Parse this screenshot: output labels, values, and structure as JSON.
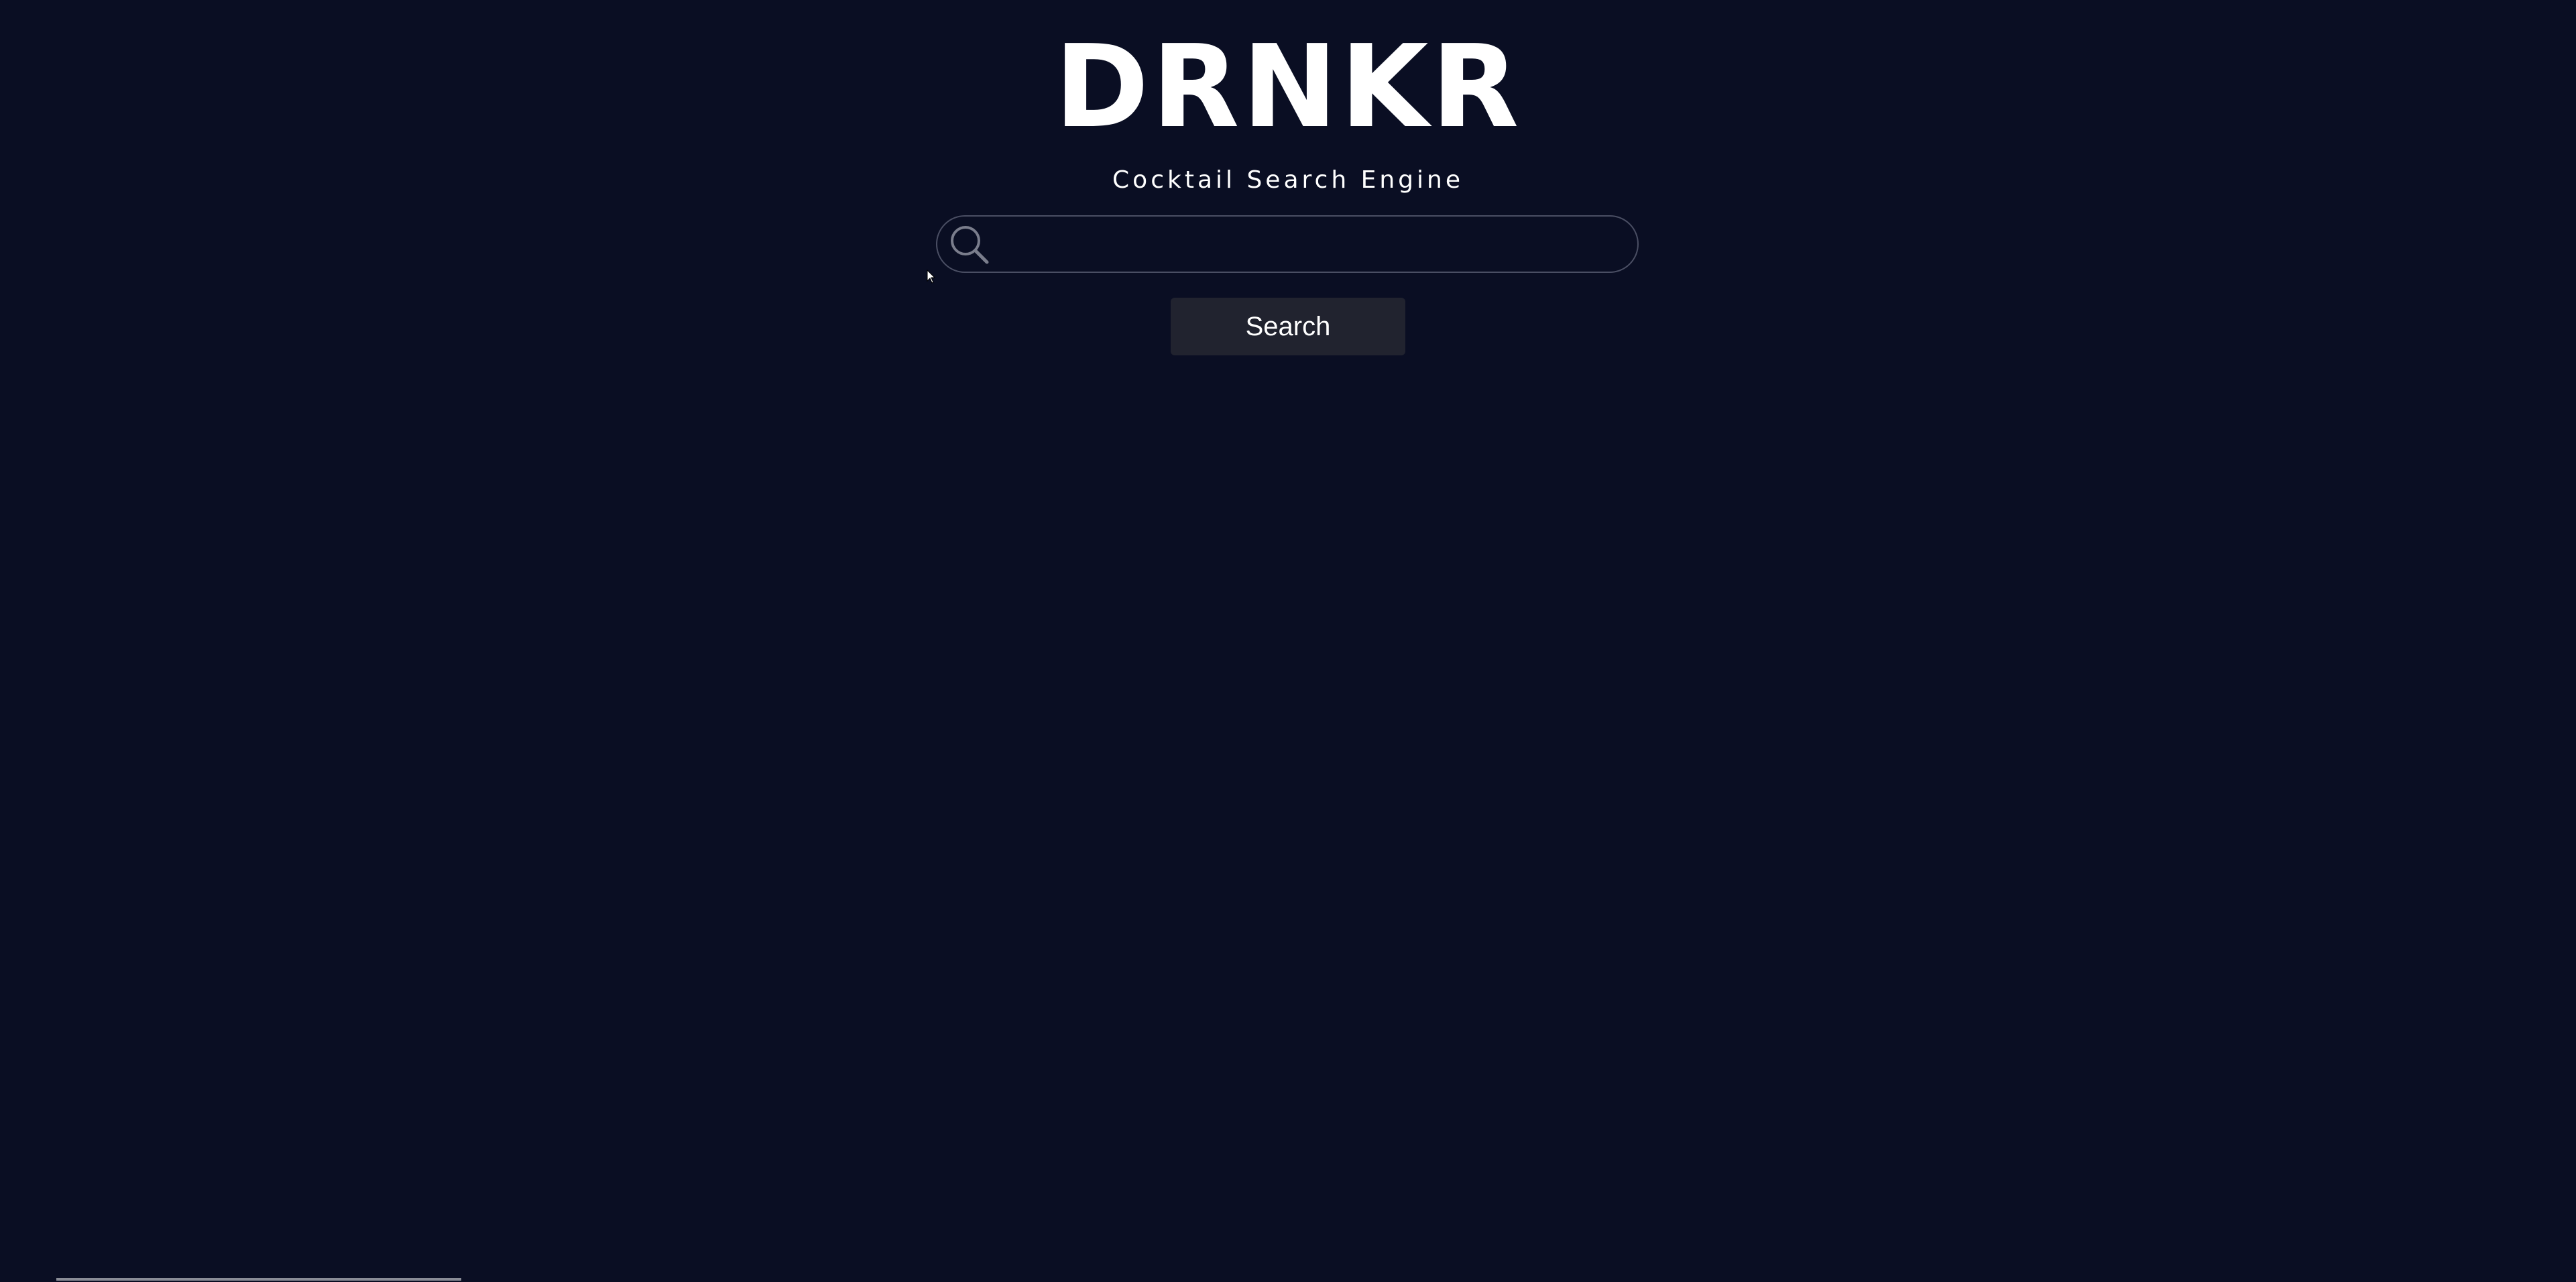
{
  "header": {
    "logo_text": "DRNKR",
    "tagline": "Cocktail Search Engine"
  },
  "search": {
    "placeholder": "",
    "value": "",
    "icon": "search-icon",
    "button_label": "Search"
  },
  "colors": {
    "background": "#0a0e23",
    "text": "#ffffff",
    "button_background": "#21232f",
    "input_border": "#4a4e63"
  }
}
